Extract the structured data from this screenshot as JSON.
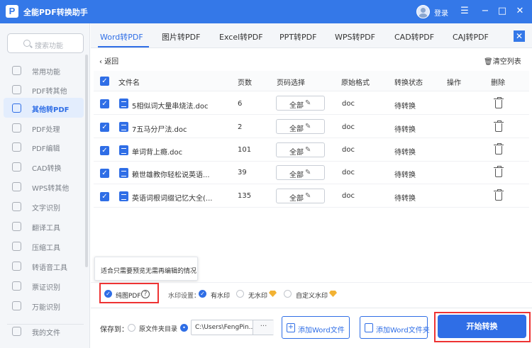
{
  "app": {
    "title": "全能PDF转换助手",
    "logo": "P",
    "login": "登录"
  },
  "window": {
    "menu_icon": "menu-icon",
    "min_icon": "minimize-icon",
    "max_icon": "maximize-icon",
    "close_icon": "close-icon"
  },
  "sidebar": {
    "search_placeholder": "搜索功能",
    "items": [
      {
        "label": "常用功能",
        "icon": "star-icon"
      },
      {
        "label": "PDF转其他",
        "icon": "pdf-icon"
      },
      {
        "label": "其他转PDF",
        "icon": "convert-icon",
        "active": true
      },
      {
        "label": "PDF处理",
        "icon": "process-icon"
      },
      {
        "label": "PDF编辑",
        "icon": "edit-icon"
      },
      {
        "label": "CAD转换",
        "icon": "cad-icon"
      },
      {
        "label": "WPS转其他",
        "icon": "wps-icon"
      },
      {
        "label": "文字识别",
        "icon": "ocr-icon"
      },
      {
        "label": "翻译工具",
        "icon": "translate-icon"
      },
      {
        "label": "压缩工具",
        "icon": "compress-icon"
      },
      {
        "label": "转语音工具",
        "icon": "voice-icon"
      },
      {
        "label": "票证识别",
        "icon": "ticket-icon"
      },
      {
        "label": "万能识别",
        "icon": "scan-icon"
      },
      {
        "label": "我的文件",
        "icon": "folder-icon"
      }
    ]
  },
  "tabs": [
    "Word转PDF",
    "图片转PDF",
    "Excel转PDF",
    "PPT转PDF",
    "WPS转PDF",
    "CAD转PDF",
    "CAJ转PDF"
  ],
  "toolbar": {
    "back": "返回",
    "clear": "清空列表"
  },
  "table": {
    "headers": {
      "name": "文件名",
      "pages": "页数",
      "page_select": "页码选择",
      "format": "原始格式",
      "status": "转换状态",
      "action": "操作",
      "delete": "删除"
    },
    "rows": [
      {
        "name": "5相似词大量串烧法.doc",
        "pages": "6",
        "range": "全部",
        "format": "doc",
        "status": "待转换"
      },
      {
        "name": "7五马分尸法.doc",
        "pages": "2",
        "range": "全部",
        "format": "doc",
        "status": "待转换"
      },
      {
        "name": "单词背上瘾.doc",
        "pages": "101",
        "range": "全部",
        "format": "doc",
        "status": "待转换"
      },
      {
        "name": "赖世雄教你轻松说英语...",
        "pages": "39",
        "range": "全部",
        "format": "doc",
        "status": "待转换"
      },
      {
        "name": "英语词根词缀记忆大全(...",
        "pages": "135",
        "range": "全部",
        "format": "doc",
        "status": "待转换"
      }
    ]
  },
  "options": {
    "tooltip": "适合只需要预览无需再编辑的情况",
    "pure_pdf": "纯图PDF",
    "watermark_label": "水印设置：",
    "watermark_on": "有水印",
    "watermark_off": "无水印",
    "watermark_custom": "自定义水印"
  },
  "footer": {
    "save_to": "保存到：",
    "source_dir": "原文件夹目录",
    "path": "C:\\Users\\FengPin...",
    "dots": "···",
    "add_file": "添加Word文件",
    "add_folder": "添加Word文件夹",
    "start": "开始转换"
  },
  "colors": {
    "accent": "#2f6ee6",
    "titlebar": "#3478e8",
    "highlight": "#e33333",
    "gem": "#f2b233"
  }
}
